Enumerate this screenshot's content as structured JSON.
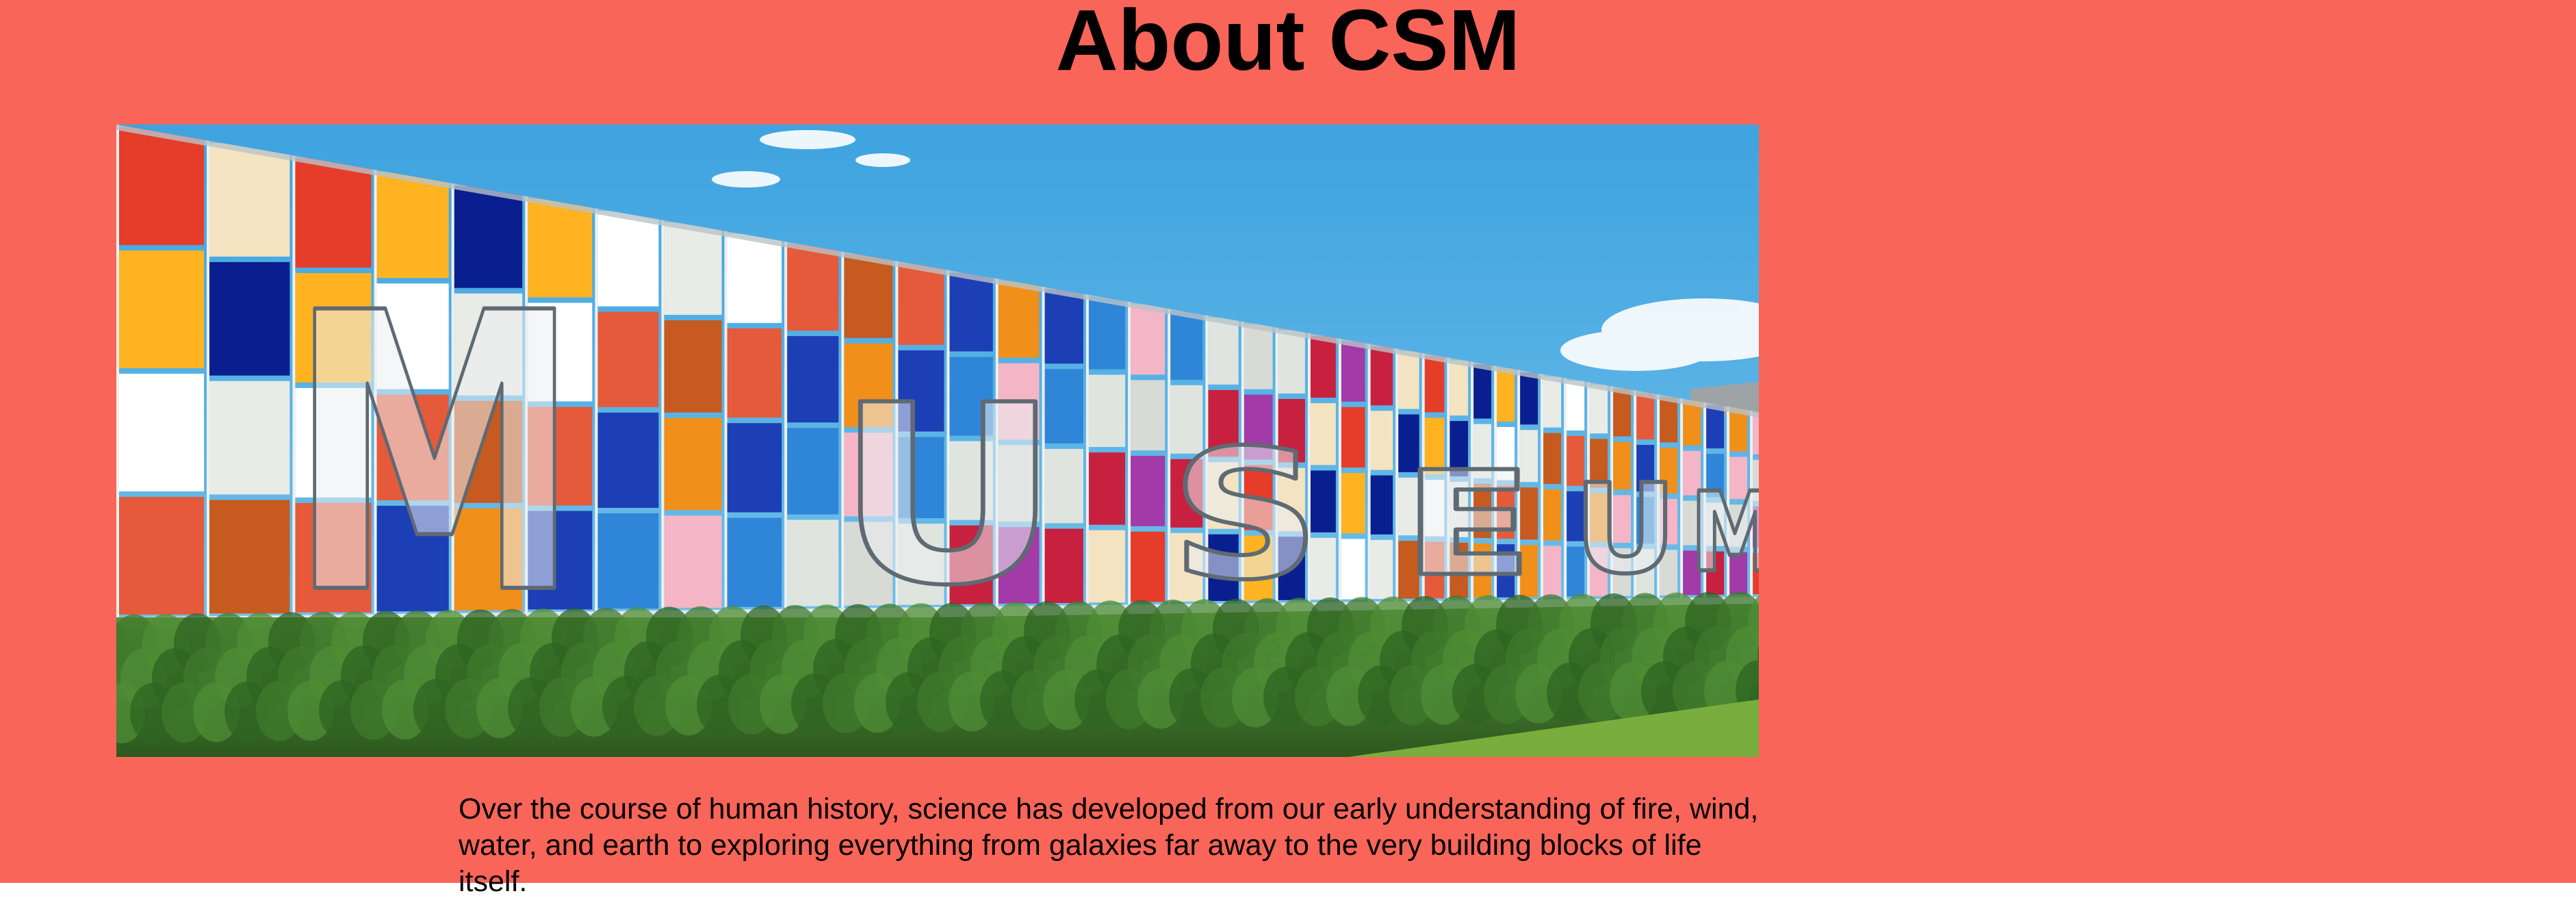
{
  "page": {
    "title": "About CSM",
    "background_color": "#fa655a"
  },
  "hero": {
    "subject": "colorful museum facade with MUSEUM letters above green shrubs",
    "sign_text": "MUSEUM"
  },
  "about": {
    "paragraph": "Over the course of human history, science has developed from our early understanding of fire, wind, water, and earth to exploring everything from galaxies far away to the very building blocks of life itself."
  }
}
